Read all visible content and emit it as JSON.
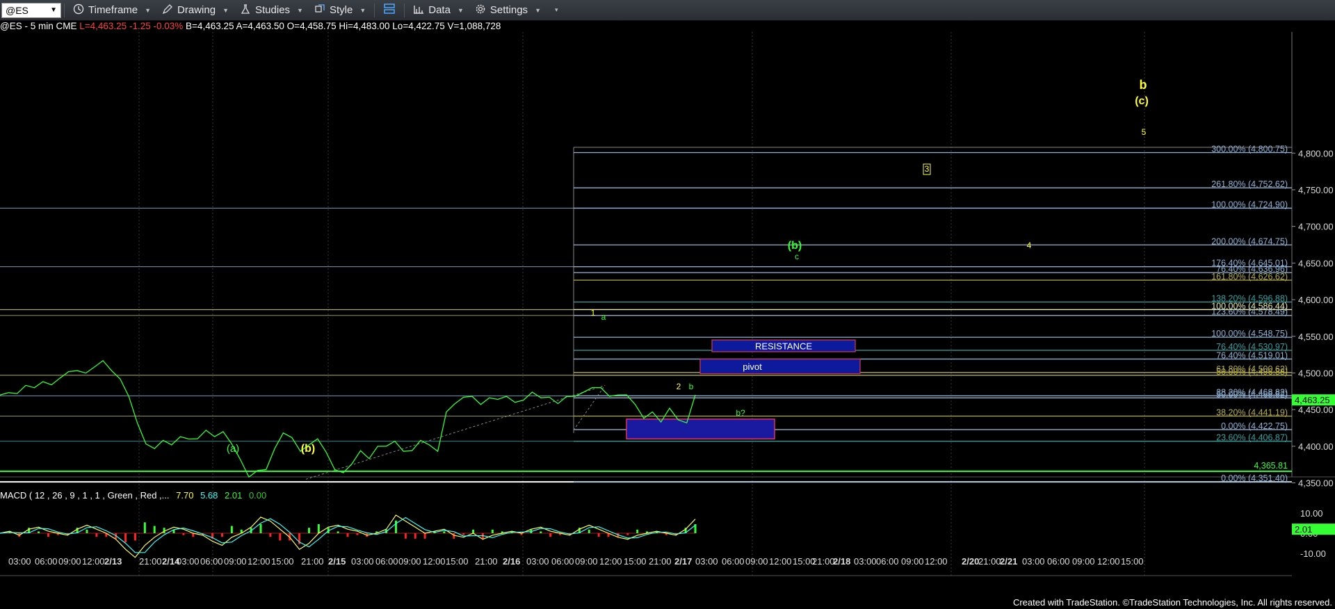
{
  "toolbar": {
    "symbol": "@ES",
    "timeframe": "Timeframe",
    "drawing": "Drawing",
    "studies": "Studies",
    "style": "Style",
    "data": "Data",
    "settings": "Settings"
  },
  "quote": {
    "prefix": "@ES - 5 min  CME  ",
    "last": "L=4,463.25",
    "change": "-1.25",
    "change_pct": "-0.03%",
    "rest": "B=4,463.25  A=4,463.50  O=4,458.75  Hi=4,483.00  Lo=4,422.75  V=1,088,728"
  },
  "macd": {
    "label": "MACD ( 12 , 26 , 9 , 1 , 1 , Green , Red ,...",
    "v1": "7.70",
    "v2": "5.68",
    "v3": "2.01",
    "v4": "0.00",
    "axis": [
      "10.00",
      "0.00",
      "-10.00"
    ],
    "current": "2.01"
  },
  "footer": "Created with TradeStation. ©TradeStation Technologies, Inc. All rights reserved.",
  "colors": {
    "price": "#33ff33",
    "fib_blue": "#8fb4d8",
    "fib_teal": "#33a3a3",
    "fib_olive": "#b8b040",
    "wave_yellow": "#ffff33",
    "wave_green": "#33ff33"
  },
  "chart_data": {
    "type": "line",
    "ylim": [
      4320,
      4820
    ],
    "y_ticks": [
      "4,800.00",
      "4,750.00",
      "4,700.00",
      "4,650.00",
      "4,600.00",
      "4,550.00",
      "4,500.00",
      "4,450.00",
      "4,400.00",
      "4,350.00"
    ],
    "x_ticks": [
      "03:00",
      "06:00",
      "09:00",
      "12:00",
      "2/13",
      "21:00",
      "2/14",
      "03:00",
      "06:00",
      "09:00",
      "12:00",
      "15:00",
      "21:00",
      "2/15",
      "03:00",
      "06:00",
      "09:00",
      "12:00",
      "15:00",
      "21:00",
      "2/16",
      "03:00",
      "06:00",
      "09:00",
      "12:00",
      "15:00",
      "21:00",
      "2/17",
      "03:00",
      "06:00",
      "09:00",
      "12:00",
      "15:00",
      "21:00",
      "2/18",
      "03:00",
      "06:00",
      "09:00",
      "12:00",
      "2/20",
      "21:00",
      "2/21",
      "03:00",
      "06:00",
      "09:00",
      "12:00",
      "15:00"
    ],
    "last_price": "4,463.25",
    "support_level": "4,365.81",
    "price_series": [
      4468,
      4475,
      4470,
      4485,
      4478,
      4490,
      4482,
      4495,
      4500,
      4505,
      4498,
      4510,
      4515,
      4505,
      4490,
      4470,
      4430,
      4405,
      4395,
      4410,
      4400,
      4415,
      4408,
      4412,
      4420,
      4415,
      4418,
      4405,
      4380,
      4360,
      4365,
      4370,
      4395,
      4420,
      4410,
      4395,
      4400,
      4412,
      4390,
      4370,
      4362,
      4378,
      4392,
      4385,
      4398,
      4402,
      4405,
      4395,
      4392,
      4410,
      4400,
      4395,
      4445,
      4460,
      4465,
      4470,
      4455,
      4468,
      4462,
      4470,
      4458,
      4465,
      4472,
      4468,
      4465,
      4460,
      4466,
      4470,
      4472,
      4482,
      4478,
      4470,
      4468,
      4472,
      4455,
      4440,
      4445,
      4435,
      4450,
      4438,
      4430,
      4472
    ],
    "macd_series": [
      0,
      1,
      -1,
      2,
      3,
      1,
      0,
      -1,
      2,
      4,
      2,
      0,
      -3,
      -8,
      -12,
      -6,
      -2,
      1,
      3,
      2,
      0,
      -1,
      -4,
      -6,
      -2,
      0,
      3,
      8,
      6,
      2,
      -2,
      -8,
      -5,
      0,
      3,
      4,
      2,
      1,
      -1,
      0,
      2,
      9,
      6,
      3,
      0,
      1,
      2,
      -1,
      -2,
      0,
      -3,
      -1,
      0,
      1,
      0,
      2,
      3,
      1,
      0,
      -1,
      2,
      4,
      2,
      0,
      -2,
      -3,
      -1,
      0,
      1,
      0,
      -1,
      2,
      7
    ],
    "fib_levels": [
      {
        "label": "300.00% (4,800.75)",
        "value": 4800.75,
        "color": "#8fb4d8"
      },
      {
        "label": "261.80% (4,752.62)",
        "value": 4752.62,
        "color": "#8fb4d8"
      },
      {
        "label": "100.00% (4,724.90)",
        "value": 4724.9,
        "color": "#8fb4d8"
      },
      {
        "label": "200.00% (4,674.75)",
        "value": 4674.75,
        "color": "#8fb4d8"
      },
      {
        "label": "176.40% (4,645.01)",
        "value": 4645.01,
        "color": "#8fb4d8"
      },
      {
        "label": "76.40% (4,636.96)",
        "value": 4636.96,
        "color": "#8fb4d8"
      },
      {
        "label": "161.80% (4,626.62)",
        "value": 4626.62,
        "color": "#b8b040"
      },
      {
        "label": "138.20% (4,596.88)",
        "value": 4596.88,
        "color": "#33a3a3"
      },
      {
        "label": "100.00% (4,586.44)",
        "value": 4586.44,
        "color": "#eeeeaa"
      },
      {
        "label": "123.60% (4,578.49)",
        "value": 4578.49,
        "color": "#8fb4d8"
      },
      {
        "label": "100.00% (4,548.75)",
        "value": 4548.75,
        "color": "#8fb4d8"
      },
      {
        "label": "76.40% (4,530.97)",
        "value": 4530.97,
        "color": "#33a3a3"
      },
      {
        "label": "76.40% (4,519.01)",
        "value": 4519.01,
        "color": "#8fb4d8"
      },
      {
        "label": "61.80% (4,500.62)",
        "value": 4500.62,
        "color": "#b8b040"
      },
      {
        "label": "50.00% (4,496.88)",
        "value": 4496.88,
        "color": "#b8b040"
      },
      {
        "label": "38.20% (4,468.82)",
        "value": 4468.82,
        "color": "#8fb4d8"
      },
      {
        "label": "50.00% (4,468.82)",
        "value": 4466.0,
        "color": "#8fb4d8"
      },
      {
        "label": "38.20% (4,441.19)",
        "value": 4441.19,
        "color": "#b8b040"
      },
      {
        "label": "0.00% (4,422.75)",
        "value": 4422.75,
        "color": "#8fb4d8"
      },
      {
        "label": "23.60% (4,406.87)",
        "value": 4406.87,
        "color": "#33a3a3"
      },
      {
        "label": "0.00% (4,351.40)",
        "value": 4351.4,
        "color": "#8fb4d8"
      }
    ],
    "zones": [
      {
        "label": "RESISTANCE",
        "top": 4545,
        "bottom": 4529
      },
      {
        "label": "pivot",
        "top": 4519,
        "bottom": 4499
      },
      {
        "label": "",
        "top": 4437,
        "bottom": 4410
      }
    ],
    "wave_labels": [
      {
        "text": "b",
        "color": "#ffff33"
      },
      {
        "text": "(c)",
        "color": "#ffff33"
      },
      {
        "text": "5",
        "color": "#ffff33"
      },
      {
        "text": "3",
        "color": "#ffff33"
      },
      {
        "text": "4",
        "color": "#ffff33"
      },
      {
        "text": "(b)",
        "color": "#33ff33"
      },
      {
        "text": "c",
        "color": "#33ff33"
      },
      {
        "text": "1",
        "color": "#ffff33"
      },
      {
        "text": "a",
        "color": "#33ff33"
      },
      {
        "text": "2",
        "color": "#ffff33"
      },
      {
        "text": "b",
        "color": "#33ff33"
      },
      {
        "text": "b?",
        "color": "#33ff33"
      },
      {
        "text": "(a)",
        "color": "#33ff33"
      },
      {
        "text": "(b)",
        "color": "#ffff33"
      }
    ]
  }
}
